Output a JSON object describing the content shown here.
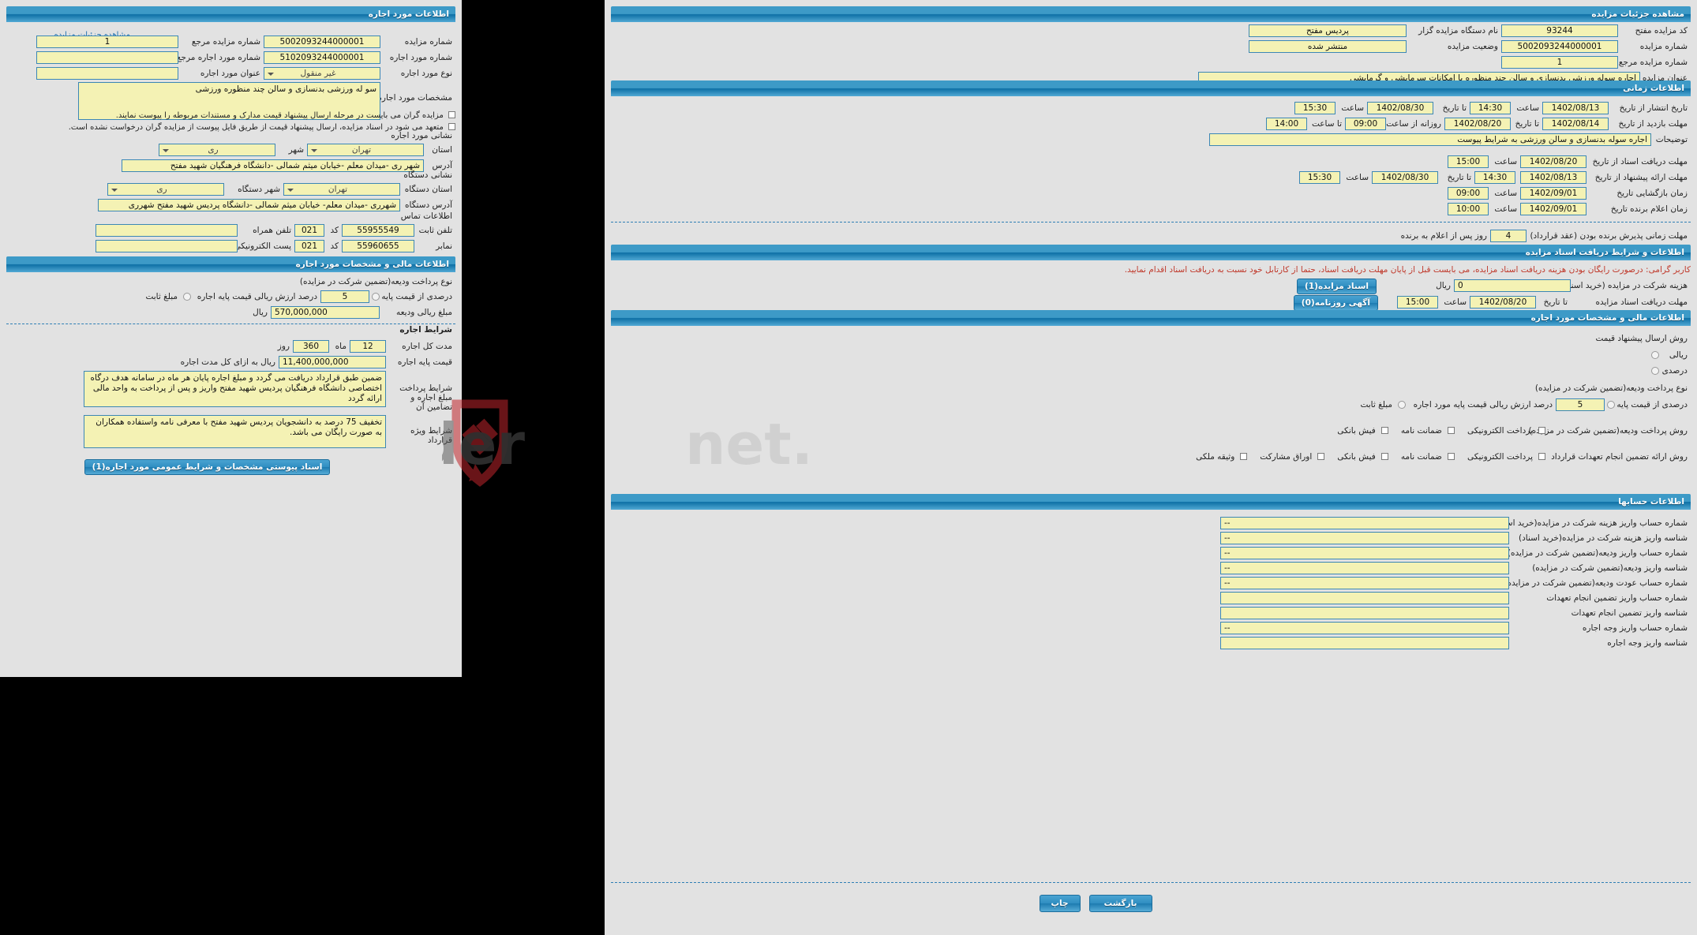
{
  "left_panel": {
    "header": "اطلاعات مورد اجاره",
    "detail_link": "مشاهده جزئیات مزایده",
    "fields": {
      "auction_number_label": "شماره مزایده",
      "auction_number_value": "5002093244000001",
      "ref_auction_number_label": "شماره مزایده مرجع",
      "ref_auction_number_value": "1",
      "lease_number_label": "شماره مورد اجاره",
      "lease_number_value": "5102093244000001",
      "ref_lease_number_label": "شماره مورد اجاره مرجع",
      "ref_lease_number_value": "",
      "lease_type_label": "نوع مورد اجاره",
      "lease_type_value": "غیر منقول",
      "lease_title_label": "عنوان مورد اجاره",
      "lease_title_value": "",
      "lease_specs_label": "مشخصات مورد اجاره",
      "lease_specs_value": "سو له ورزشی بدنسازی و سالن چند منظوره ورزشی"
    },
    "checkboxes": [
      "مزایده گران می بایست در مرحله ارسال پیشنهاد قیمت مدارک و مستندات مربوطه را پیوست نمایند.",
      "متعهد می شود در اسناد مزایده، ارسال پیشنهاد قیمت از طریق فایل پیوست از مزایده گران درخواست نشده است."
    ],
    "address_section": {
      "title": "نشانی مورد اجاره",
      "province_label": "استان",
      "province_value": "تهران",
      "city_label": "شهر",
      "city_value": "ری",
      "address_label": "آدرس",
      "address_value": "شهر ری -میدان معلم -خیابان میثم شمالی -دانشگاه فرهنگیان شهید مفتح"
    },
    "org_address_section": {
      "title": "نشانی دستگاه",
      "province_label": "استان دستگاه",
      "province_value": "تهران",
      "city_label": "شهر دستگاه",
      "city_value": "ری",
      "address_label": "آدرس دستگاه",
      "address_value": "شهرری -میدان معلم- خیابان میثم شمالی -دانشگاه پردیس شهید مفتح شهرری"
    },
    "contact_section": {
      "title": "اطلاعات تماس",
      "phone_label": "تلفن ثابت",
      "phone_value": "55955549",
      "phone_code_label": "کد",
      "phone_code_value": "021",
      "mobile_label": "تلفن همراه",
      "mobile_value": "",
      "fax_label": "نمابر",
      "fax_value": "55960655",
      "fax_code_label": "کد",
      "fax_code_value": "021",
      "email_label": "پست الکترونیکی",
      "email_value": ""
    },
    "financial": {
      "header": "اطلاعات مالی و مشخصات مورد اجاره",
      "deposit_method_label": "نوع پرداخت ودیعه(تضمین شرکت در مزایده)",
      "percent_base_label": "درصدی از قیمت پایه",
      "percent_base_value": "5",
      "percent_base_suffix": "درصد ارزش ریالی قیمت پایه اجاره",
      "fixed_amount_label": "مبلغ ثابت",
      "deposit_amount_label": "مبلغ ریالی ودیعه",
      "deposit_amount_value": "570,000,000",
      "currency": "ریال"
    },
    "lease_terms": {
      "header": "شرایط اجاره",
      "total_period_label": "مدت کل اجاره",
      "months_value": "12",
      "months_unit": "ماه",
      "days_value": "360",
      "days_unit": "روز",
      "base_price_label": "قیمت پایه اجاره",
      "base_price_value": "11,400,000,000",
      "base_price_suffix": "ریال به ازای کل مدت اجاره",
      "guarantee_text": "ضمین طبق قرارداد دریافت می گردد و مبلغ اجاره پایان هر ماه در سامانه هدف درگاه اختصاصی دانشگاه فرهنگیان پردیس شهید مفتح واریز و پس از پرداخت به واحد مالی ارائه گردد",
      "guarantee_label": "شرایط پرداخت مبلغ اجاره و تضامین آن",
      "special_terms_text": "تخفیف 75 درصد به دانشجویان پردیس شهید مفتح با معرفی نامه واستفاده همکاران به صورت رایگان می باشد.",
      "special_terms_label": "شرایط ویژه قرارداد",
      "attachment_button": "اسناد پیوستی مشخصات و شرایط عمومی مورد اجاره(1)"
    }
  },
  "right_panel": {
    "header": "مشاهده جزئیات مزایده",
    "top": {
      "auction_code_label": "کد مزایده مفتح",
      "auction_code_value": "93244",
      "org_name_label": "نام دستگاه مزایده گزار",
      "org_name_value": "پردیس مفتح",
      "auction_number_label": "شماره مزایده",
      "auction_number_value": "5002093244000001",
      "status_label": "وضعیت مزایده",
      "status_value": "منتشر شده",
      "ref_number_label": "شماره مزایده مرجع",
      "ref_number_value": "1",
      "title_label": "عنوان مزایده",
      "title_value": "اجاره سوله ورزشی بدنسازی و سالن چند منظوره با امکانات سرمایشی و گرمایشی"
    },
    "time_section": {
      "header": "اطلاعات زمانی",
      "rows": [
        {
          "label": "تاریخ انتشار   از تاریخ",
          "from_date": "1402/08/13",
          "time1_label": "ساعت",
          "time1": "14:30",
          "to_label": "تا تاریخ",
          "to_date": "1402/08/30",
          "time2_label": "ساعت",
          "time2": "15:30"
        },
        {
          "label": "مهلت بازدید  از تاریخ",
          "from_date": "1402/08/14",
          "time1_label": "تا تاریخ",
          "time1": "1402/08/20",
          "to_label": "روزانه از ساعت",
          "to_date": "09:00",
          "time2_label": "تا ساعت",
          "time2": "14:00"
        }
      ],
      "notes_label": "توضیحات",
      "notes_value": "اجاره سوله بدنسازی و سالن ورزشی به شرایط پیوست",
      "rows2": [
        {
          "label": "مهلت دریافت اسناد  از تاریخ",
          "from_date": "1402/08/20",
          "time_label": "ساعت",
          "time": "15:00"
        },
        {
          "label": "مهلت ارائه پیشنهاد   از تاریخ",
          "from_date": "1402/08/13",
          "time1": "14:30",
          "to_label": "تا تاریخ",
          "to_date": "1402/08/30",
          "time2": "15:30"
        },
        {
          "label": "زمان بازگشایی   تاریخ",
          "date": "1402/09/01",
          "time_label": "ساعت",
          "time": "09:00"
        },
        {
          "label": "زمان اعلام برنده   تاریخ",
          "date": "1402/09/01",
          "time_label": "ساعت",
          "time": "10:00"
        }
      ],
      "acceptance_label": "مهلت زمانی پذیرش برنده بودن (عقد قرارداد)",
      "acceptance_value": "4",
      "acceptance_suffix": "روز پس از اعلام به برنده"
    },
    "docs_section": {
      "header": "اطلاعات و شرایط دریافت اسناد مزایده",
      "warning": "کاربر گرامی: درصورت رایگان بودن هزینه دریافت اسناد مزایده، می بایست قبل از پایان مهلت دریافت اسناد، حتما از کارتابل خود نسبت به دریافت اسناد اقدام نمایید.",
      "cost_label": "هزینه شرکت در مزایده (خرید اسناد)",
      "cost_value": "0",
      "cost_currency": "ریال",
      "docs_button": "اسناد مزایده(1)",
      "deadline_label": "مهلت دریافت اسناد مزایده",
      "deadline_to_label": "تا تاریخ",
      "deadline_date": "1402/08/20",
      "deadline_time_label": "ساعت",
      "deadline_time": "15:00",
      "newspaper_button": "آگهی روزنامه(0)"
    },
    "financial_section": {
      "header": "اطلاعات مالی و مشخصات مورد اجاره",
      "submit_method_label": "روش ارسال پیشنهاد قیمت",
      "rial_label": "ریالی",
      "percent_label": "درصدی",
      "deposit_type_label": "نوع پرداخت ودیعه(تضمین شرکت در مزایده)",
      "percent_base_label": "درصدی از قیمت پایه",
      "percent_base_value": "5",
      "percent_base_suffix": "درصد ارزش ریالی قیمت پایه مورد اجاره",
      "fixed_label": "مبلغ ثابت",
      "deposit_pay_label": "روش پرداخت ودیعه(تضمین شرکت در مزایده)",
      "deposit_options": [
        "پرداخت الکترونیکی",
        "ضمانت نامه",
        "فیش بانکی"
      ],
      "contract_guarantee_label": "روش ارائه تضمین انجام تعهدات قرارداد",
      "contract_options": [
        "پرداخت الکترونیکی",
        "ضمانت نامه",
        "فیش بانکی",
        "اوراق مشارکت",
        "وثیقه ملکی"
      ]
    },
    "accounts_section": {
      "header": "اطلاعات حسابها",
      "rows": [
        {
          "label": "شماره حساب واریز هزینه شرکت در مزایده(خرید اسناد)",
          "value": "--"
        },
        {
          "label": "شناسه واریز هزینه شرکت در مزایده(خرید اسناد)",
          "value": "--"
        },
        {
          "label": "شماره حساب واریز ودیعه(تضمین شرکت در مزایده)",
          "value": "--"
        },
        {
          "label": "شناسه واریز ودیعه(تضمین شرکت در مزایده)",
          "value": "--"
        },
        {
          "label": "شماره حساب عودت ودیعه(تضمین شرکت در مزایده)",
          "value": "--"
        },
        {
          "label": "شماره حساب واریز تضمین انجام تعهدات",
          "value": ""
        },
        {
          "label": "شناسه واریز تضمین انجام تعهدات",
          "value": ""
        },
        {
          "label": "شماره حساب واریز وجه اجاره",
          "value": "--"
        },
        {
          "label": "شناسه واریز وجه اجاره",
          "value": ""
        }
      ]
    },
    "footer": {
      "back_button": "بازگشت",
      "print_button": "چاپ"
    }
  },
  "watermark": {
    "text": "AriaTender.net",
    "logo_color": "#c0262c",
    "text_color": "#555555"
  },
  "colors": {
    "header_blue": "#2f8ec1",
    "field_yellow": "#f4f2b4",
    "field_border": "#3c87b5",
    "panel_bg": "#e2e2e2",
    "warning_red": "#c0392b"
  }
}
